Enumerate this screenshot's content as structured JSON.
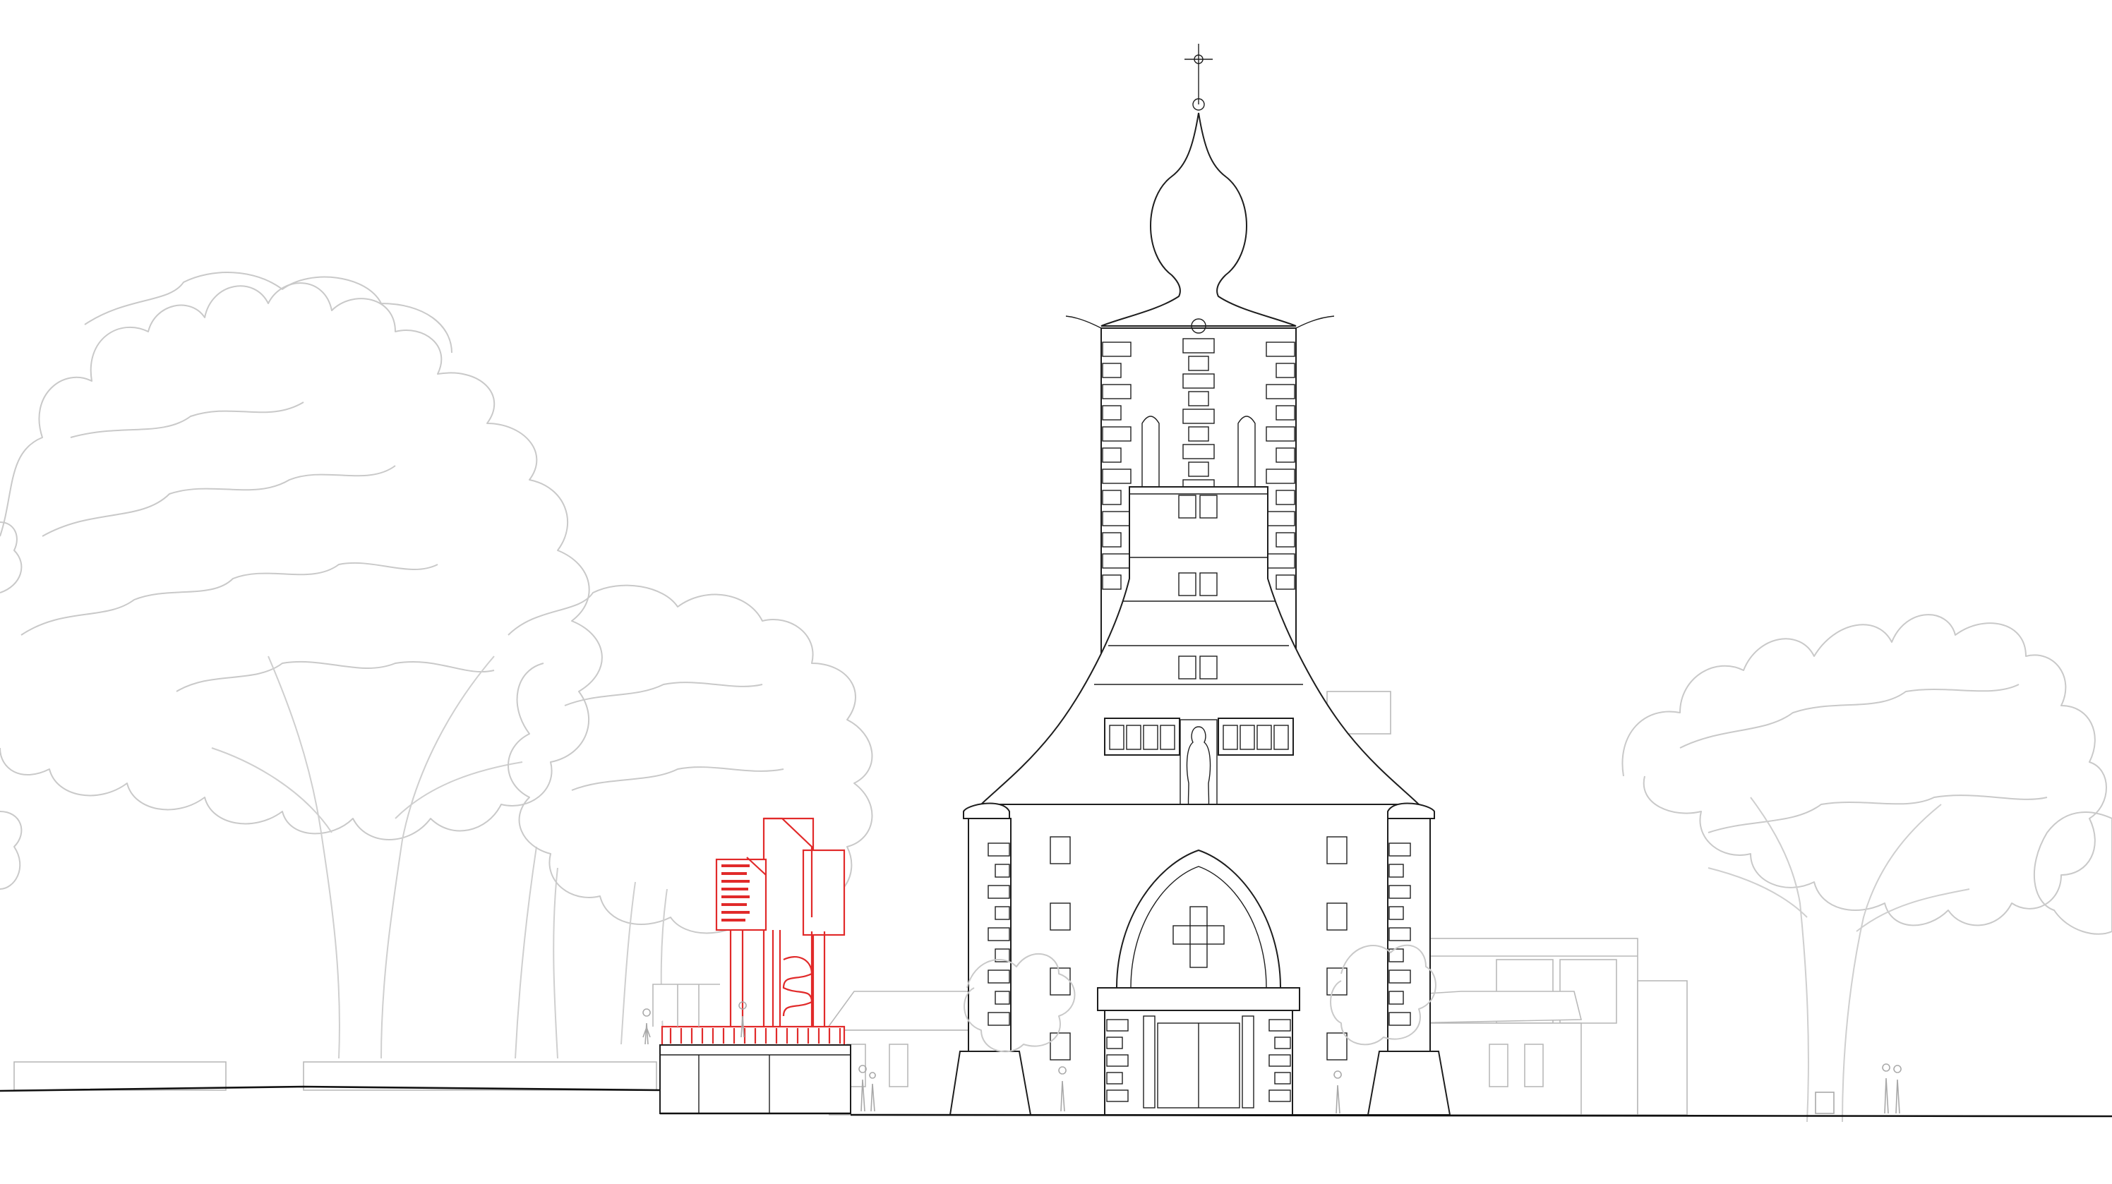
{
  "drawing": {
    "type": "architectural elevation",
    "line_color": "#1e1e1e",
    "tree_color": "#c9c9c9",
    "accent_color": "#e12a2a",
    "background": "#ffffff"
  },
  "pavilion_sign": {
    "lines": []
  },
  "icons": [
    "cross-finial-icon",
    "statue-icon"
  ]
}
